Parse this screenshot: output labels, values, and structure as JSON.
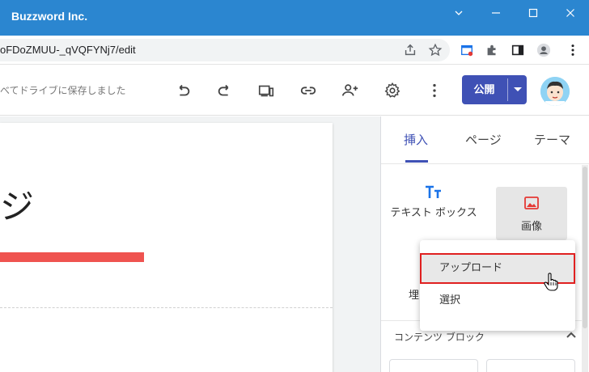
{
  "window": {
    "title": "Buzzword Inc.",
    "controls": [
      "chevron-down",
      "minimize",
      "maximize",
      "close"
    ]
  },
  "address_bar": {
    "url": "oFDoZMUU-_qVQFYNj7/edit",
    "icons": [
      "share-icon",
      "star-icon",
      "extension-clip-icon",
      "puzzle-icon",
      "sidepanel-icon",
      "profile-icon",
      "kebab-icon"
    ]
  },
  "toolbar": {
    "saved_status": "べてドライブに保存しました",
    "icons": [
      "undo-icon",
      "redo-icon",
      "preview-icon",
      "link-icon",
      "add-person-icon",
      "settings-icon",
      "more-icon"
    ],
    "publish_label": "公開",
    "colors": {
      "publish": "#3f51b5"
    }
  },
  "canvas": {
    "heading": "ジ",
    "accent_bar_color": "#ef5350"
  },
  "panel": {
    "tabs": [
      {
        "label": "挿入",
        "active": true
      },
      {
        "label": "ページ",
        "active": false
      },
      {
        "label": "テーマ",
        "active": false
      }
    ],
    "insert_items": {
      "text_box": "テキスト ボックス",
      "image": "画像",
      "embed": "埋"
    },
    "content_block_label": "コンテンツ ブロック"
  },
  "dropdown": {
    "items": [
      {
        "label": "アップロード",
        "highlighted": true
      },
      {
        "label": "選択",
        "highlighted": false
      }
    ]
  }
}
